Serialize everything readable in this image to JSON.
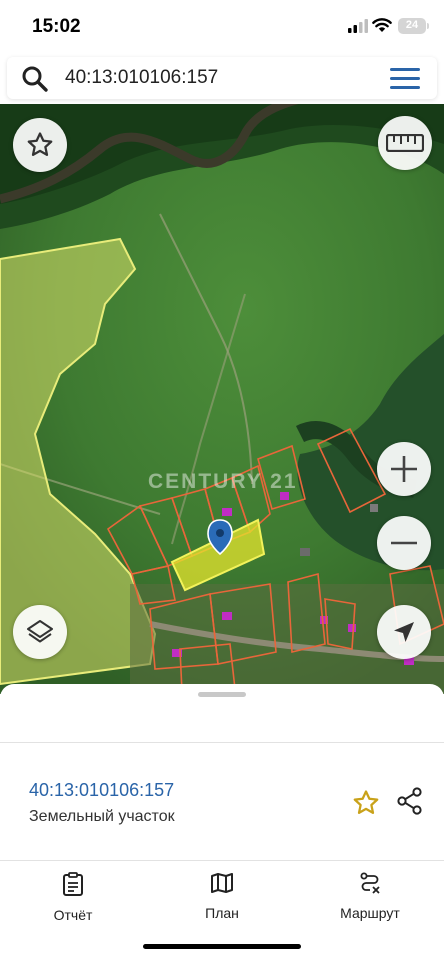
{
  "status": {
    "time": "15:02",
    "battery": "24"
  },
  "search": {
    "query": "40:13:010106:157"
  },
  "map": {
    "watermark": "CENTURY 21"
  },
  "parcel": {
    "cadastral_number": "40:13:010106:157",
    "type": "Земельный участок"
  },
  "tabs": [
    {
      "label": "Отчёт",
      "icon": "report-icon"
    },
    {
      "label": "План",
      "icon": "map-plan-icon"
    },
    {
      "label": "Маршрут",
      "icon": "route-icon"
    }
  ],
  "colors": {
    "accent": "#2a64a8",
    "parcel_fill": "#e6e62e",
    "boundary": "#e8663a",
    "zone": "#d8e06a"
  }
}
